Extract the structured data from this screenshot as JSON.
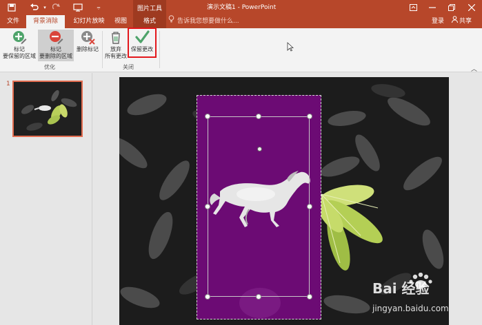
{
  "titlebar": {
    "context_group": "图片工具",
    "window_title": "演示文稿1 - PowerPoint",
    "icons": [
      "save-icon",
      "undo-icon",
      "redo-icon",
      "slideshow-from-start-icon",
      "customize-qat-icon"
    ],
    "controls": [
      "ribbon-display-options-icon",
      "minimize-icon",
      "restore-icon",
      "close-icon"
    ]
  },
  "tabs": {
    "file": "文件",
    "background_removal": "背景消除",
    "slideshow": "幻灯片放映",
    "view": "视图",
    "format": "格式",
    "tell_me": "告诉我您想要做什么...",
    "login": "登录",
    "share": "共享"
  },
  "ribbon": {
    "mark_keep_line1": "标记",
    "mark_keep_line2": "要保留的区域",
    "mark_remove_line1": "标记",
    "mark_remove_line2": "要删除的区域",
    "delete_mark": "删除标记",
    "discard_line1": "放弃",
    "discard_line2": "所有更改",
    "keep_changes": "保留更改",
    "group_refine": "优化",
    "group_close": "关闭"
  },
  "thumbnails": {
    "slide_number": "1"
  },
  "watermark": {
    "brand": "Bai 经验",
    "url": "jingyan.baidu.com"
  },
  "colors": {
    "accent": "#b7472a",
    "removal_overlay": "#6c0b74",
    "highlight_box": "#e3161b",
    "keep_check": "#4ea36a"
  }
}
